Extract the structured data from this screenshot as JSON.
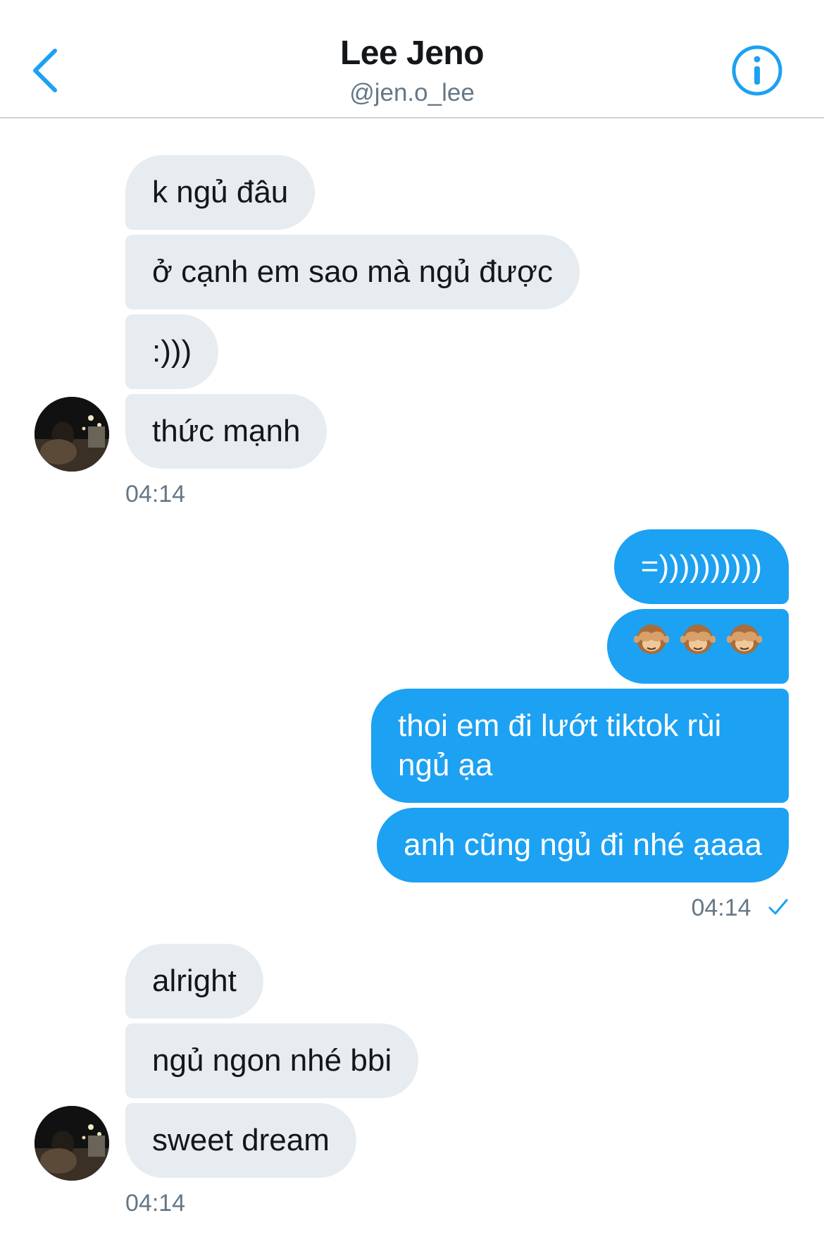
{
  "header": {
    "title": "Lee Jeno",
    "handle": "@jen.o_lee",
    "back_icon": "chevron-left-icon",
    "info_icon": "info-icon",
    "accent": "#1da1f2"
  },
  "messages": {
    "group1": [
      "k ngủ đâu",
      "ở cạnh em sao mà ngủ được",
      ":)))",
      "thức mạnh"
    ],
    "group1_time": "04:14",
    "group2": [
      "=))))))))))",
      "🙈🙈🙈",
      "thoi em đi lướt tiktok rùi ngủ ạa",
      "anh cũng ngủ đi nhé ạaaa"
    ],
    "group2_time": "04:14",
    "group3": [
      "alright",
      "ngủ ngon nhé bbi",
      "sweet dream"
    ],
    "group3_time": "04:14"
  },
  "colors": {
    "incoming_bubble": "#e6ecf0",
    "outgoing_bubble": "#1da1f2",
    "timestamp": "#657786"
  }
}
